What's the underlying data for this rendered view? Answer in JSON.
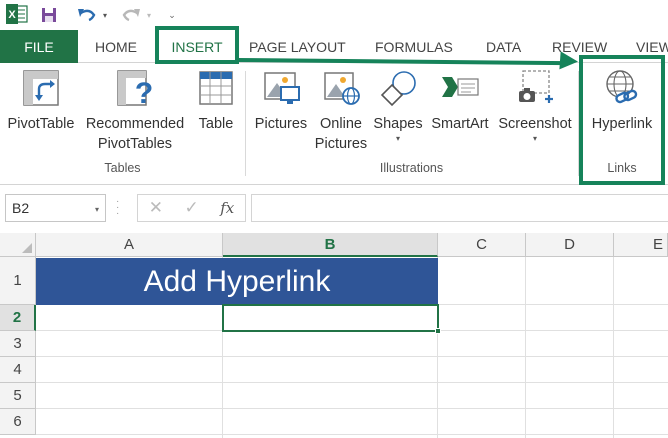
{
  "quick_access": {
    "undo_caret": "▾",
    "redo_caret": "▾",
    "customize": "⌄"
  },
  "tabs": {
    "file": "FILE",
    "items": [
      "HOME",
      "INSERT",
      "PAGE LAYOUT",
      "FORMULAS",
      "DATA",
      "REVIEW",
      "VIEW"
    ]
  },
  "ribbon": {
    "tables": {
      "pivot_table": "PivotTable",
      "recommended_line1": "Recommended",
      "recommended_line2": "PivotTables",
      "table": "Table",
      "group_label": "Tables"
    },
    "illustrations": {
      "pictures": "Pictures",
      "online_line1": "Online",
      "online_line2": "Pictures",
      "shapes": "Shapes",
      "smartart": "SmartArt",
      "screenshot": "Screenshot",
      "group_label": "Illustrations"
    },
    "links": {
      "hyperlink": "Hyperlink",
      "group_label": "Links"
    }
  },
  "formula_bar": {
    "name_box": "B2",
    "cancel": "✕",
    "enter": "✓",
    "fx": "fx",
    "value": ""
  },
  "sheet": {
    "columns": [
      "A",
      "B",
      "C",
      "D",
      "E"
    ],
    "rows": [
      "1",
      "2",
      "3",
      "4",
      "5",
      "6"
    ],
    "active_cell": "B2",
    "merged_a1_b1": "Add Hyperlink"
  },
  "colors": {
    "excel_green": "#217346",
    "annotation_green": "#16835a",
    "header_fill": "#2f5597"
  }
}
